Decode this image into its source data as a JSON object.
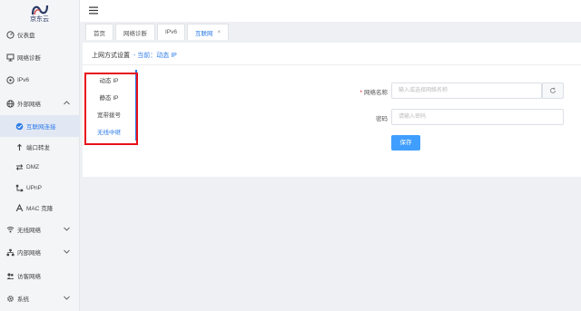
{
  "app": {
    "logo_text": "京东云"
  },
  "sidebar": {
    "items": [
      {
        "label": "仪表盘",
        "icon": "dashboard-icon"
      },
      {
        "label": "网络诊断",
        "icon": "network-diagnose-icon"
      },
      {
        "label": "IPv6",
        "icon": "ipv6-icon"
      },
      {
        "label": "外部网络",
        "icon": "globe-icon"
      },
      {
        "label": "互联网连接",
        "icon": "internet-connection-icon"
      },
      {
        "label": "端口转发",
        "icon": "port-forward-icon"
      },
      {
        "label": "DMZ",
        "icon": "dmz-icon"
      },
      {
        "label": "UPnP",
        "icon": "upnp-icon"
      },
      {
        "label": "MAC 克隆",
        "icon": "mac-clone-icon"
      },
      {
        "label": "无线网络",
        "icon": "wireless-icon"
      },
      {
        "label": "内部网络",
        "icon": "lan-icon"
      },
      {
        "label": "访客网络",
        "icon": "guest-icon"
      },
      {
        "label": "系统",
        "icon": "gear-icon"
      }
    ]
  },
  "tabs": [
    {
      "label": "首页"
    },
    {
      "label": "网络诊断"
    },
    {
      "label": "IPv6"
    },
    {
      "label": "互联网",
      "close": "×"
    }
  ],
  "content": {
    "title": "上网方式设置",
    "current": "- 当前：动态 IP",
    "connection_types": [
      "动态 IP",
      "静态 IP",
      "宽带拨号",
      "无线中继"
    ],
    "form": {
      "ssid_label": "网络名称",
      "ssid_required": "*",
      "ssid_placeholder": "输入或选择网络名称",
      "password_label": "密码",
      "password_placeholder": "请输入密码",
      "save_label": "保存"
    }
  },
  "colors": {
    "accent": "#2e7be8",
    "highlight": "#e8101a",
    "button": "#409eff"
  }
}
